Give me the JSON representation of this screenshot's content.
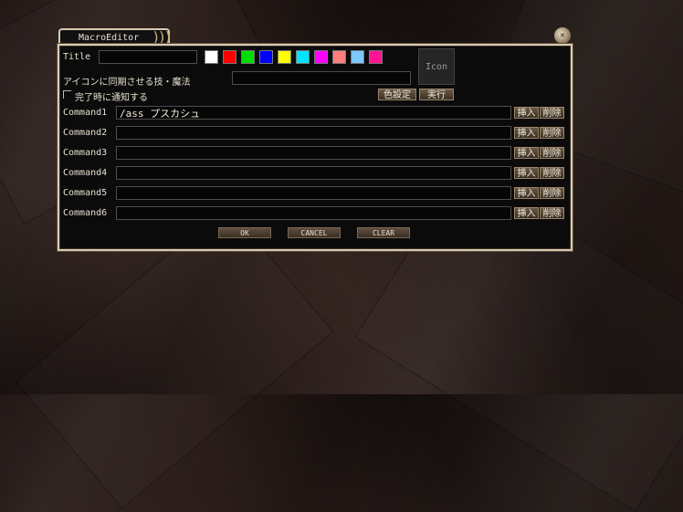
{
  "window": {
    "title": "MacroEditor",
    "title_label": "Title",
    "title_value": "",
    "skill_label": "アイコンに同期させる技・魔法",
    "skill_value": "",
    "notify_label": "完了時に通知する",
    "notify_checked": false,
    "icon_label": "Icon",
    "color_setting_button": "色設定",
    "execute_button": "実行"
  },
  "colors": [
    "#ffffff",
    "#ff0000",
    "#00dd00",
    "#0000ff",
    "#ffff00",
    "#00e5ff",
    "#ff00ff",
    "#ff7f7f",
    "#7fc8ff",
    "#ff1493"
  ],
  "commands": [
    {
      "label": "Command1",
      "value": "/ass プスカシュ",
      "insert": "挿入",
      "delete": "削除"
    },
    {
      "label": "Command2",
      "value": "",
      "insert": "挿入",
      "delete": "削除"
    },
    {
      "label": "Command3",
      "value": "",
      "insert": "挿入",
      "delete": "削除"
    },
    {
      "label": "Command4",
      "value": "",
      "insert": "挿入",
      "delete": "削除"
    },
    {
      "label": "Command5",
      "value": "",
      "insert": "挿入",
      "delete": "削除"
    },
    {
      "label": "Command6",
      "value": "",
      "insert": "挿入",
      "delete": "削除"
    }
  ],
  "footer": {
    "ok": "OK",
    "cancel": "CANCEL",
    "clear": "CLEAR"
  }
}
